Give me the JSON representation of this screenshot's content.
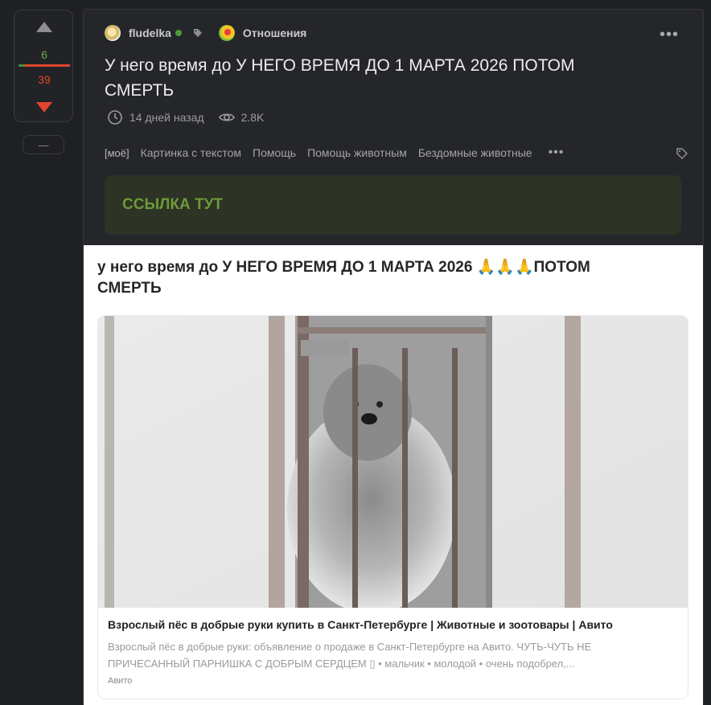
{
  "vote": {
    "plus": "6",
    "minus": "39",
    "positive_fraction": 0.13,
    "collapse_label": "—"
  },
  "post": {
    "author": "fludelka",
    "community": "Отношения",
    "title": "У него время до У НЕГО ВРЕМЯ ДО 1 МАРТА 2026 ПОТОМ СМЕРТЬ",
    "time_ago": "14 дней назад",
    "views": "2.8K",
    "tags": [
      "[моё]",
      "Картинка с текстом",
      "Помощь",
      "Помощь животным",
      "Бездомные животные"
    ],
    "tags_more": "•••",
    "menu": "•••",
    "link_text": "ССЫЛКА ТУТ"
  },
  "embed": {
    "heading": "у него время до У НЕГО ВРЕМЯ ДО 1 МАРТА 2026 🙏🙏🙏ПОТОМ СМЕРТЬ",
    "card_title": "Взрослый пёс в добрые руки купить в Санкт-Петербурге | Животные и зоотовары | Авито",
    "card_desc": "Взрослый пёс в добрые руки: объявление о продаже в Санкт-Петербурге на Авито. ЧУТЬ-ЧУТЬ НЕ ПРИЧЕСАННЫЙ ПАРНИШКА С ДОБРЫМ СЕРДЦЕМ ▯ • мальчик • молодой • очень подобрел,...",
    "card_source": "Авито"
  },
  "colors": {
    "bg": "#1f2023",
    "card": "#25262a",
    "link_green": "#6d9a3a",
    "minus_red": "#e2452f",
    "plus_green": "#6aa84f"
  },
  "icons": {
    "up": "arrow-up-icon",
    "down": "arrow-down-icon",
    "clock": "clock-icon",
    "eye": "eye-icon",
    "tag": "tag-icon"
  }
}
